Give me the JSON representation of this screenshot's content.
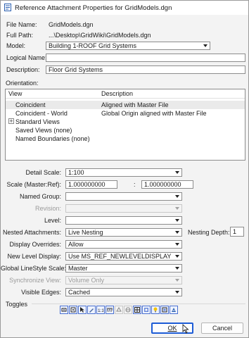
{
  "window": {
    "title": "Reference Attachment Properties for GridModels.dgn"
  },
  "info": {
    "file_name_label": "File Name:",
    "file_name_value": "GridModels.dgn",
    "full_path_label": "Full Path:",
    "full_path_value": "...\\Desktop\\GridWiki\\GridModels.dgn",
    "model_label": "Model:",
    "model_value": "Building 1-ROOF Grid Systems",
    "logical_name_label": "Logical Name:",
    "logical_name_value": "",
    "description_label": "Description:",
    "description_value": "Floor Grid Systems"
  },
  "orientation": {
    "label": "Orientation:",
    "col_view": "View",
    "col_description": "Description",
    "rows": [
      {
        "view": "Coincident",
        "description": "Aligned with Master File",
        "selected": true
      },
      {
        "view": "Coincident - World",
        "description": "Global Origin aligned with Master File"
      },
      {
        "view": "Standard Views",
        "description": "",
        "expander": "+"
      },
      {
        "view": "Saved Views (none)",
        "description": ""
      },
      {
        "view": "Named Boundaries (none)",
        "description": ""
      }
    ]
  },
  "settings": {
    "detail_scale_label": "Detail Scale:",
    "detail_scale_value": "1:100",
    "scale_label": "Scale (Master:Ref):",
    "scale_master": "1.000000000",
    "scale_sep": ":",
    "scale_ref": "1.000000000",
    "named_group_label": "Named Group:",
    "named_group_value": "",
    "revision_label": "Revision:",
    "revision_value": "",
    "level_label": "Level:",
    "level_value": "",
    "nested_attachments_label": "Nested Attachments:",
    "nested_attachments_value": "Live Nesting",
    "nesting_depth_label": "Nesting Depth:",
    "nesting_depth_value": "1",
    "display_overrides_label": "Display Overrides:",
    "display_overrides_value": "Allow",
    "new_level_display_label": "New Level Display:",
    "new_level_display_value": "Use MS_REF_NEWLEVELDISPLAY Configura",
    "global_linestyle_label": "Global LineStyle Scale:",
    "global_linestyle_value": "Master",
    "synchronize_view_label": "Synchronize View:",
    "synchronize_view_value": "Volume Only",
    "visible_edges_label": "Visible Edges:",
    "visible_edges_value": "Cached"
  },
  "toggles": {
    "label": "Toggles"
  },
  "buttons": {
    "ok": "OK",
    "cancel": "Cancel"
  },
  "colors": {
    "accent": "#1d5cd6",
    "toggle_border": "#4a70d0"
  }
}
